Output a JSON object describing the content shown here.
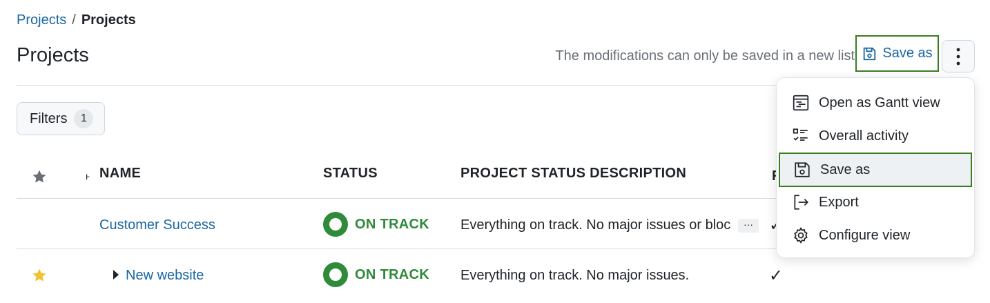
{
  "breadcrumb": {
    "parent": "Projects",
    "separator": "/",
    "current": "Projects"
  },
  "page": {
    "title": "Projects"
  },
  "toolbar": {
    "notice": "The modifications can only be saved in a new list",
    "save_as_label": "Save as",
    "save_icon": "floppy-disk-icon",
    "more_icon": "kebab-menu-icon"
  },
  "filters": {
    "label": "Filters",
    "count": "1"
  },
  "table": {
    "columns": {
      "name": "NAME",
      "status": "STATUS",
      "description": "PROJECT STATUS DESCRIPTION",
      "partial": "F"
    },
    "rows": [
      {
        "name": "Customer Success",
        "status": "ON TRACK",
        "description": "Everything on track. No major issues or blockers.",
        "more": "···",
        "favorite": false,
        "has_children": false,
        "check": "✓"
      },
      {
        "name": "New website",
        "status": "ON TRACK",
        "description": "Everything on track. No major issues.",
        "favorite": true,
        "has_children": true,
        "check": "✓"
      }
    ]
  },
  "menu": {
    "items": [
      {
        "label": "Open as Gantt view",
        "icon": "gantt-icon"
      },
      {
        "label": "Overall activity",
        "icon": "activity-list-icon"
      },
      {
        "label": "Save as",
        "icon": "floppy-disk-icon",
        "highlighted": true
      },
      {
        "label": "Export",
        "icon": "export-icon"
      },
      {
        "label": "Configure view",
        "icon": "gear-icon"
      }
    ]
  },
  "colors": {
    "link": "#1a67a3",
    "status_green": "#2f8a3a",
    "highlight_border": "#3a7d1e",
    "favorite_star": "#f2c230",
    "header_star": "#6a6f75"
  }
}
